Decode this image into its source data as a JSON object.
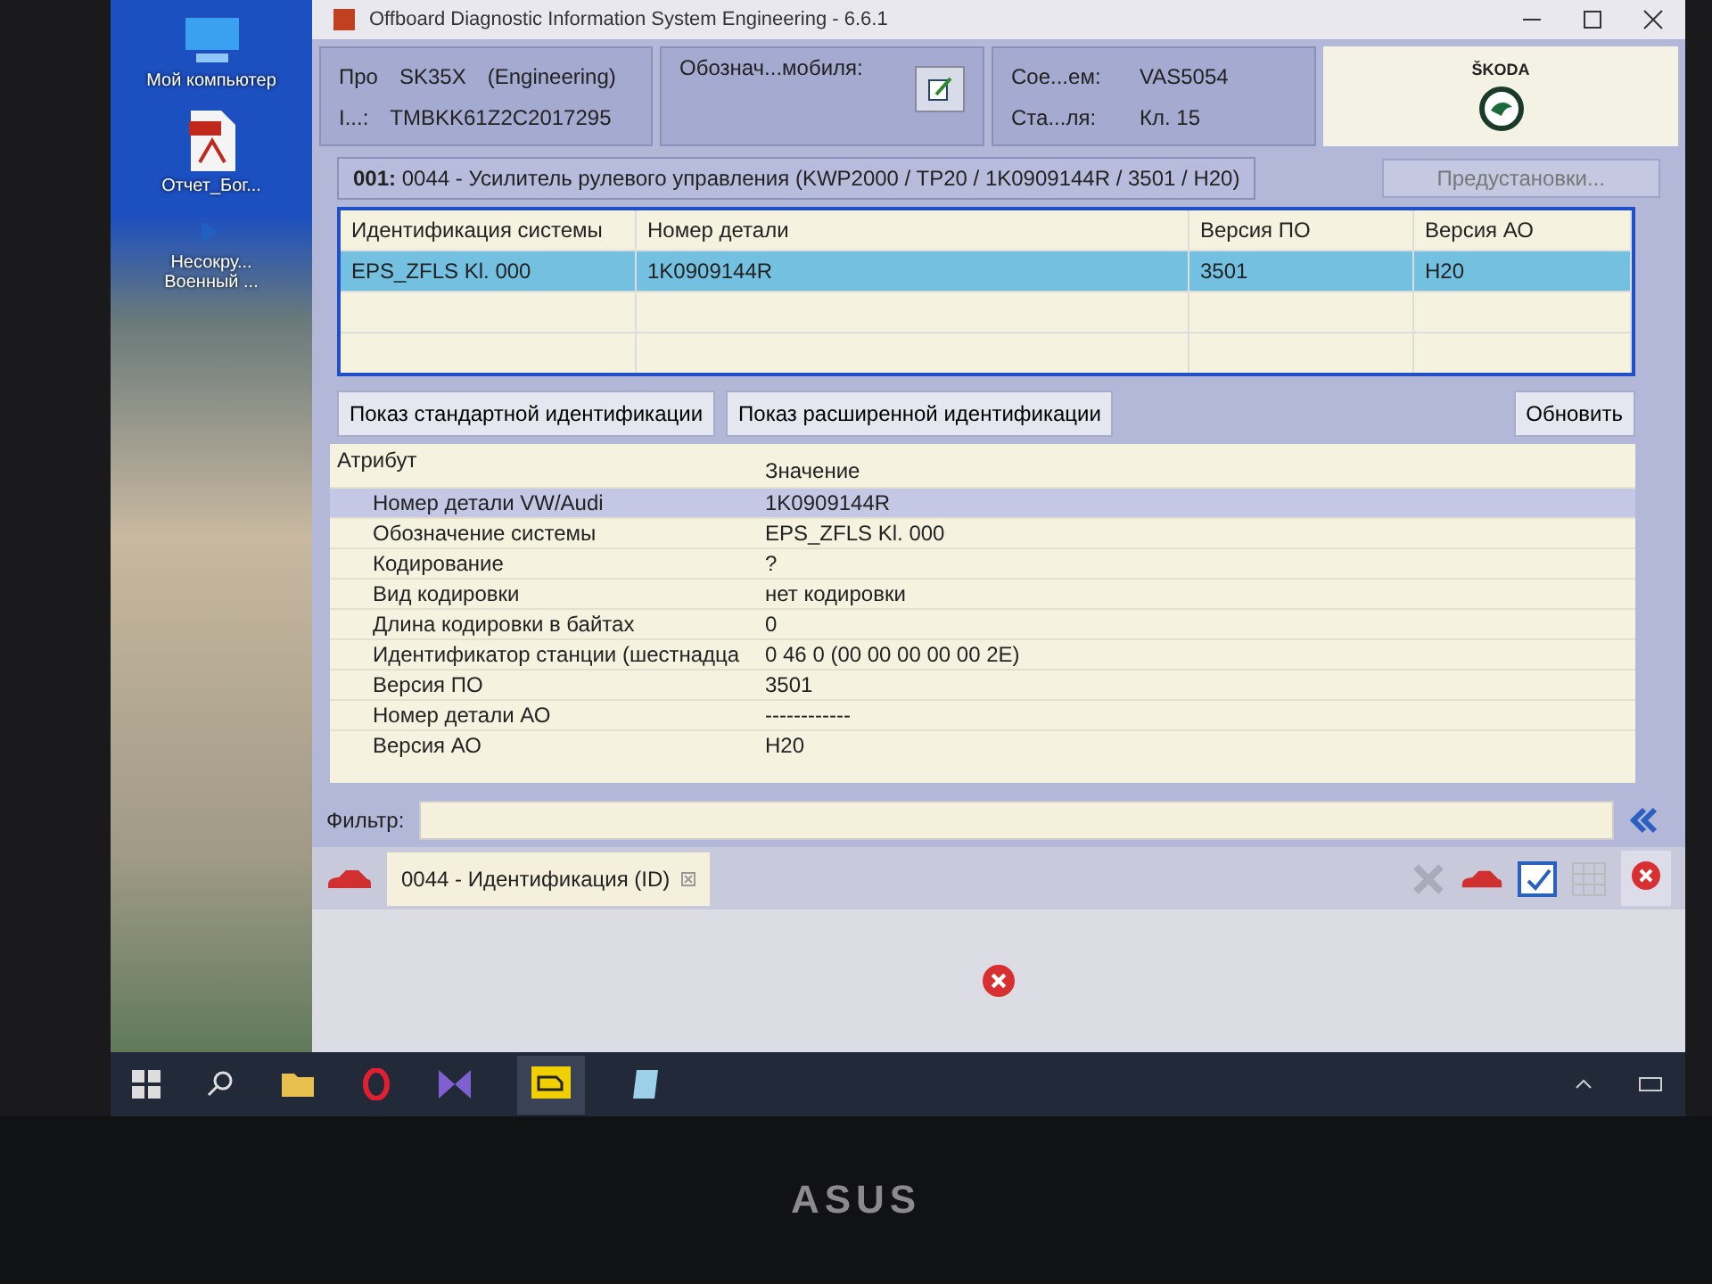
{
  "desktop": {
    "icons": [
      {
        "kind": "computer",
        "label": "Мой компьютер"
      },
      {
        "kind": "pdf",
        "label": "Отчет_Бог..."
      },
      {
        "kind": "file",
        "label": "Несокру... Военный ..."
      }
    ]
  },
  "window": {
    "title": "Offboard Diagnostic Information System Engineering - 6.6.1"
  },
  "header": {
    "profile_label": "Про",
    "profile_value": "SK35X",
    "profile_mode": "(Engineering)",
    "vin_label": "І...:",
    "vin_value": "TMBKK61Z2C2017295",
    "designation_label": "Обознач...мобиля:",
    "connection_label": "Сое...ем:",
    "connection_value": "VAS5054",
    "state_label": "Ста...ля:",
    "state_value": "Кл. 15",
    "brand": "ŠKODA"
  },
  "control_unit": "**001:** 0044 - Усилитель рулевого управления  (KWP2000 / TP20 / 1K0909144R  / 3501 / H20)",
  "presets_button": "Предустановки...",
  "systems_table": {
    "columns": [
      "Идентификация системы",
      "Номер детали",
      "Версия ПО",
      "Версия АО"
    ],
    "rows": [
      {
        "selected": true,
        "cells": [
          "EPS_ZFLS Kl. 000",
          "1K0909144R",
          "3501",
          "H20"
        ]
      }
    ]
  },
  "view_buttons": [
    "Показ стандартной идентификации",
    "Показ расширенной идентификации"
  ],
  "refresh_button": "Обновить",
  "attributes": {
    "columns": [
      "Атрибут",
      "Значение"
    ],
    "rows": [
      {
        "selected": true,
        "name": "Номер детали VW/Audi",
        "value": "1K0909144R"
      },
      {
        "selected": false,
        "name": "Обозначение системы",
        "value": "EPS_ZFLS Kl. 000"
      },
      {
        "selected": false,
        "name": "Кодирование",
        "value": "?"
      },
      {
        "selected": false,
        "name": "Вид кодировки",
        "value": "нет кодировки"
      },
      {
        "selected": false,
        "name": "Длина кодировки в байтах",
        "value": "0"
      },
      {
        "selected": false,
        "name": "Идентификатор станции (шестнадца",
        "value": "0 46 0 (00 00 00 00 00 2E)"
      },
      {
        "selected": false,
        "name": "Версия ПО",
        "value": "3501"
      },
      {
        "selected": false,
        "name": "Номер детали АО",
        "value": "------------"
      },
      {
        "selected": false,
        "name": "Версия АО",
        "value": "H20"
      }
    ]
  },
  "filter": {
    "label": "Фильтр:"
  },
  "tab": {
    "label": "0044 - Идентификация (ID)"
  },
  "bezel": {
    "logo": "ASUS"
  }
}
